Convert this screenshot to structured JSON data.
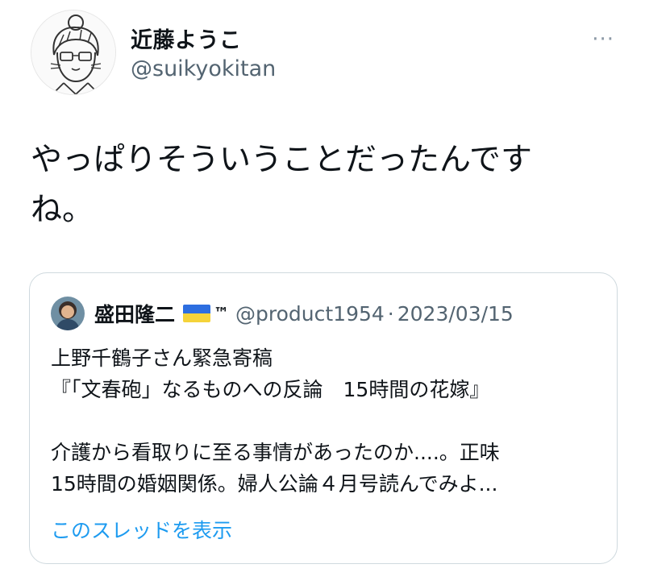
{
  "author": {
    "display_name": "近藤ようこ",
    "handle": "@suikyokitan"
  },
  "more_menu_label": "···",
  "tweet": {
    "text_line1": "やっぱりそういうことだったんです",
    "text_line2": "ね。"
  },
  "quoted_tweet": {
    "display_name": "盛田隆二",
    "flag_icon": "ukraine-flag-icon",
    "tm": "™",
    "handle": "@product1954",
    "separator": "·",
    "date": "2023/03/15",
    "lines": [
      "上野千鶴子さん緊急寄稿",
      "『「文春砲」なるものへの反論　15時間の花嫁』",
      "",
      "介護から看取りに至る事情があったのか....。正味",
      "15時間の婚姻関係。婦人公論４月号読んでみよ..."
    ],
    "show_thread_label": "このスレッドを表示"
  },
  "colors": {
    "text": "#0f1419",
    "secondary": "#536471",
    "link": "#1d9bf0",
    "border": "#cfd9de"
  }
}
